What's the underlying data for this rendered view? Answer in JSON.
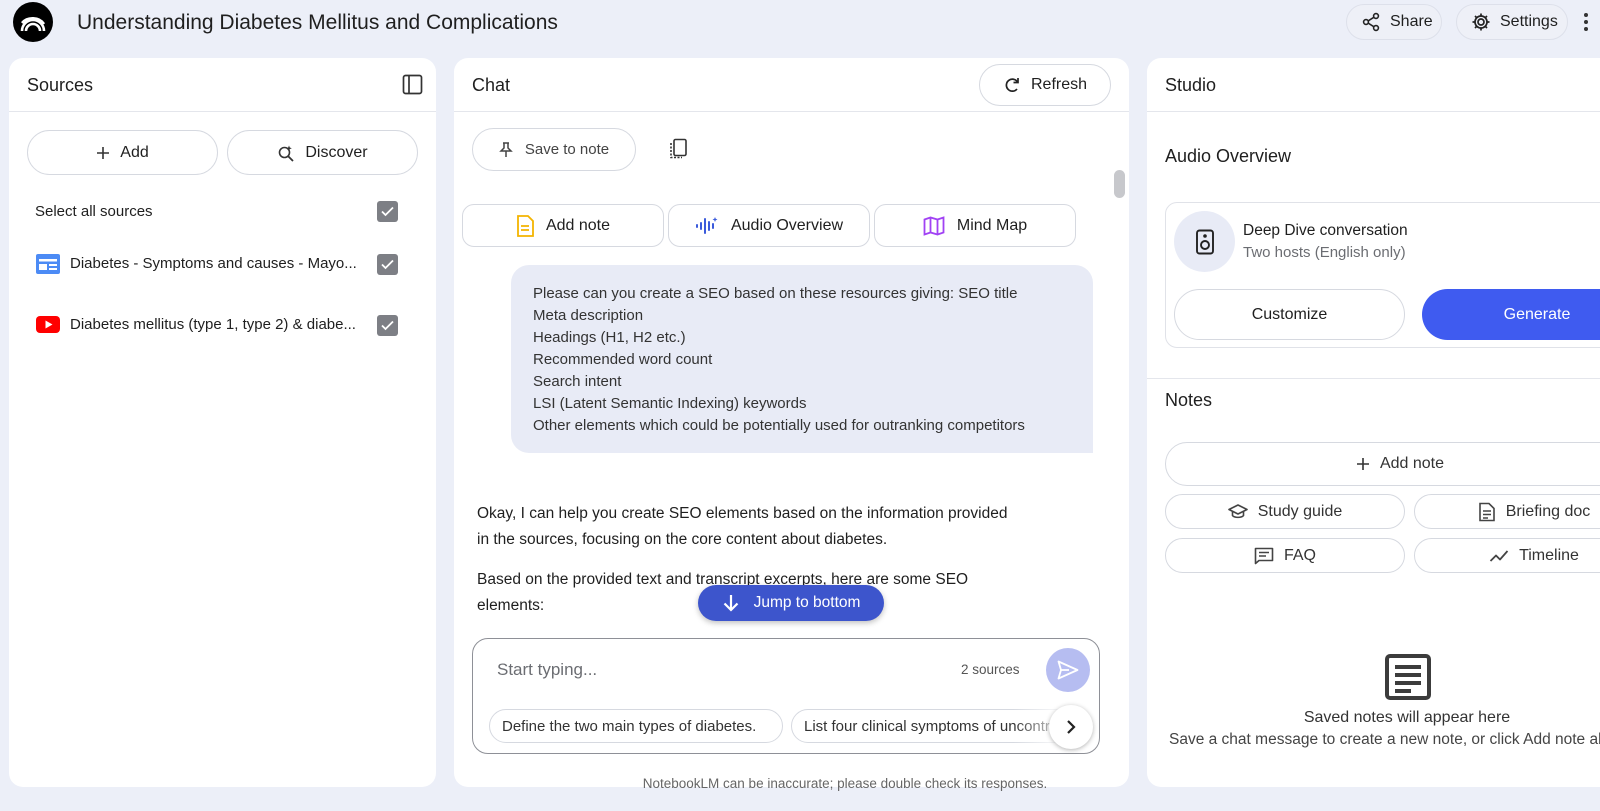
{
  "app": {
    "title": "Understanding Diabetes Mellitus and Complications",
    "share_label": "Share",
    "settings_label": "Settings"
  },
  "sources": {
    "title": "Sources",
    "add_label": "Add",
    "discover_label": "Discover",
    "select_all_label": "Select all sources",
    "items": [
      {
        "label": "Diabetes - Symptoms and causes - Mayo...",
        "type": "web",
        "checked": true
      },
      {
        "label": "Diabetes mellitus (type 1, type 2) & diabe...",
        "type": "youtube",
        "checked": true
      }
    ]
  },
  "chat": {
    "title": "Chat",
    "refresh_label": "Refresh",
    "save_to_note_label": "Save to note",
    "actions": [
      {
        "label": "Add note",
        "icon": "note-icon",
        "color": "#f4b400"
      },
      {
        "label": "Audio Overview",
        "icon": "audio-waveform-icon",
        "color": "#3b5bdb"
      },
      {
        "label": "Mind Map",
        "icon": "map-icon",
        "color": "#a142f4"
      }
    ],
    "user_message_lines": [
      "Please can you create a SEO based on these resources giving: SEO title",
      "Meta description",
      "Headings (H1, H2 etc.)",
      "Recommended word count",
      "Search intent",
      "LSI (Latent Semantic Indexing) keywords",
      "Other elements which could be potentially used for outranking competitors"
    ],
    "reply_paragraphs": [
      "Okay, I can help you create SEO elements based on the information provided in the sources, focusing on the core content about diabetes.",
      "Based on the provided text and transcript excerpts, here are some SEO elements:"
    ],
    "jump_label": "Jump to bottom",
    "composer_placeholder": "Start typing...",
    "sources_count": "2 sources",
    "suggestions": [
      "Define the two main types of diabetes.",
      "List four clinical symptoms of uncontrolled diabetes."
    ]
  },
  "studio": {
    "title": "Studio",
    "audio_title": "Audio Overview",
    "audio_card": {
      "name": "Deep Dive conversation",
      "subtitle": "Two hosts (English only)",
      "customize_label": "Customize",
      "generate_label": "Generate"
    },
    "notes_title": "Notes",
    "add_note_label": "Add note",
    "note_chips": [
      {
        "label": "Study guide",
        "icon": "graduation-cap-icon"
      },
      {
        "label": "Briefing doc",
        "icon": "document-list-icon"
      },
      {
        "label": "FAQ",
        "icon": "faq-icon"
      },
      {
        "label": "Timeline",
        "icon": "timeline-icon"
      }
    ],
    "empty_title": "Saved notes will appear here",
    "empty_subtitle": "Save a chat message to create a new note, or click Add note above."
  },
  "footer": "NotebookLM can be inaccurate; please double check its responses.",
  "colors": {
    "accent": "#3f5bf0",
    "jump_button": "#3d55cc",
    "background": "#eceff8"
  }
}
